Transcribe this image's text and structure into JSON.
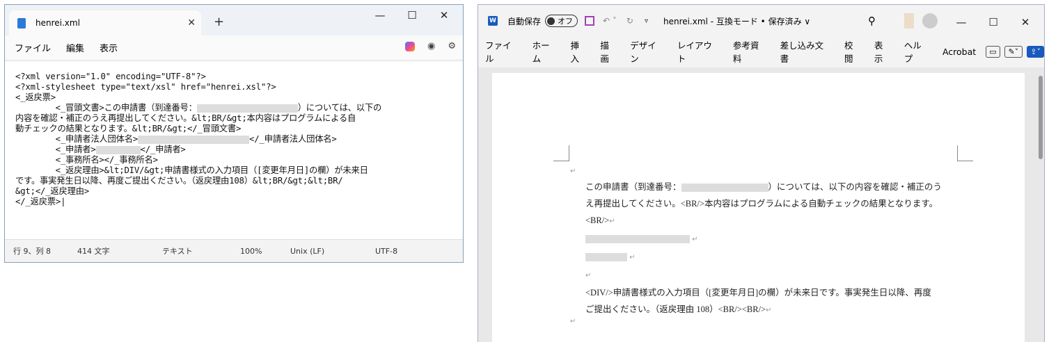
{
  "notepad": {
    "tab_title": "henrei.xml",
    "tab_close": "✕",
    "new_tab": "+",
    "window_controls": [
      "—",
      "☐",
      "✕"
    ],
    "menu": [
      "ファイル",
      "編集",
      "表示"
    ],
    "editor": {
      "l1": "<?xml version=\"1.0\" encoding=\"UTF-8\"?>",
      "l2": "<?xml-stylesheet type=\"text/xsl\" href=\"henrei.xsl\"?>",
      "l3": "<_返戻票>",
      "l4a": "        <_冒頭文書>この申請書（到達番号：",
      "l4b": "）については、以下の",
      "l5": "内容を確認・補正のうえ再提出してください。&lt;BR/&gt;本内容はプログラムによる自",
      "l6": "動チェックの結果となります。&lt;BR/&gt;</_冒頭文書>",
      "l7a": "        <_申請者法人団体名>",
      "l7b": "</_申請者法人団体名>",
      "l8a": "        <_申請者>",
      "l8b": "</_申請者>",
      "l9": "        <_事務所名></_事務所名>",
      "l10": "        <_返戻理由>&lt;DIV/&gt;申請書様式の入力項目（[変更年月日]の欄）が未来日",
      "l11": "です。事実発生日以降、再度ご提出ください。（返戻理由108）&lt;BR/&gt;&lt;BR/",
      "l12": "&gt;</_返戻理由>",
      "l13": "</_返戻票>"
    },
    "status": {
      "position": "行 9、列 8",
      "chars": "414 文字",
      "mode": "テキスト",
      "zoom": "100%",
      "eol": "Unix (LF)",
      "encoding": "UTF-8"
    }
  },
  "word": {
    "autosave_label": "自動保存",
    "autosave_state": "オフ",
    "title": "henrei.xml  -  互換モード • 保存済み ∨",
    "window_controls": [
      "—",
      "☐",
      "✕"
    ],
    "tabs": [
      "ファイル",
      "ホーム",
      "挿入",
      "描画",
      "デザイン",
      "レイアウト",
      "参考資料",
      "差し込み文書",
      "校閲",
      "表示",
      "ヘルプ",
      "Acrobat"
    ],
    "doc": {
      "p1a": "この申請書（到達番号：",
      "p1b": "）については、以下の内容を確認・補正のう",
      "p2": "え再提出してください。<BR/>本内容はプログラムによる自動チェックの結果となります。",
      "p3": "<BR/>",
      "p4": "<DIV/>申請書様式の入力項目（[変更年月日]の欄）が未来日です。事実発生日以降、再度",
      "p5": "ご提出ください。（返戻理由 108）<BR/><BR/>",
      "mark": "↵"
    }
  }
}
